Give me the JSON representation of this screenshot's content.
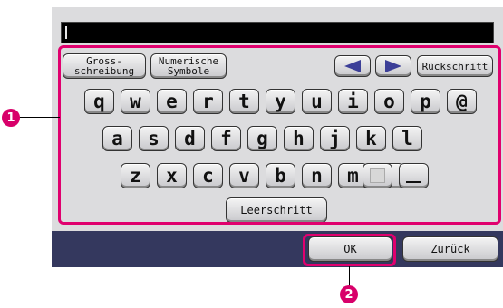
{
  "input": {
    "value": ""
  },
  "mode_keys": {
    "uppercase_line1": "Gross-",
    "uppercase_line2": "schreibung",
    "symbols_line1": "Numerische",
    "symbols_line2": "Symbole"
  },
  "nav": {
    "backspace": "Rückschritt",
    "left_icon": "arrow-left-icon",
    "right_icon": "arrow-right-icon"
  },
  "keyboard": {
    "row1": [
      "q",
      "w",
      "e",
      "r",
      "t",
      "y",
      "u",
      "i",
      "o",
      "p",
      "@"
    ],
    "row2": [
      "a",
      "s",
      "d",
      "f",
      "g",
      "h",
      "j",
      "k",
      "l"
    ],
    "row3": [
      "z",
      "x",
      "c",
      "v",
      "b",
      "n",
      "m",
      "."
    ],
    "space": "Leerschritt"
  },
  "footer": {
    "ok": "OK",
    "back": "Zurück"
  },
  "callouts": {
    "one": "1",
    "two": "2"
  },
  "colors": {
    "highlight": "#e0006e",
    "footer_bar": "#34385e",
    "screen": "#dcdcde"
  }
}
